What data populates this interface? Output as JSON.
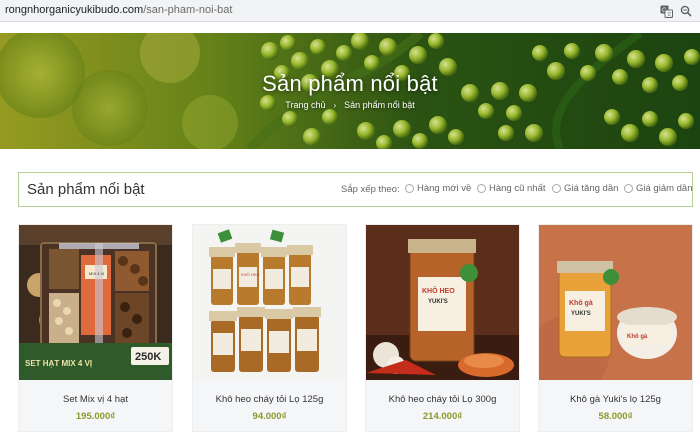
{
  "browser": {
    "url_domain": "rongnhorganicyukibudo.com",
    "url_path": "/san-pham-noi-bat",
    "icons": [
      "translate-icon",
      "zoom-icon"
    ]
  },
  "hero": {
    "title": "Sản phẩm nổi bật",
    "breadcrumb_home": "Trang chủ",
    "breadcrumb_separator": "›",
    "breadcrumb_current": "Sản phẩm nổi bật"
  },
  "filter": {
    "title": "Sản phẩm nổi bật",
    "sort_label": "Sắp xếp theo:",
    "options": [
      "Hàng mới về",
      "Hàng cũ nhất",
      "Giá tăng dần",
      "Giá giảm dần"
    ]
  },
  "products": [
    {
      "name": "Set Mix vị 4 hạt",
      "price": "195.000₫",
      "image_text": [
        "SET HẠT MIX 4 VỊ",
        "250K",
        "MIX 4 VỊ"
      ]
    },
    {
      "name": "Khô heo cháy tỏi Lọ 125g",
      "price": "94.000₫",
      "image_text": [
        "KHÔ HEO"
      ]
    },
    {
      "name": "Khô heo cháy tỏi Lọ 300g",
      "price": "214.000₫",
      "image_text": [
        "KHÔ HEO",
        "YUKI'S"
      ]
    },
    {
      "name": "Khô gà Yuki's lọ 125g",
      "price": "58.000₫",
      "image_text": [
        "Khô gà",
        "YUKI'S"
      ]
    }
  ],
  "colors": {
    "accent_border": "#b8cf93",
    "price": "#8a9a2c",
    "hero_bg": "#3d5e14"
  }
}
